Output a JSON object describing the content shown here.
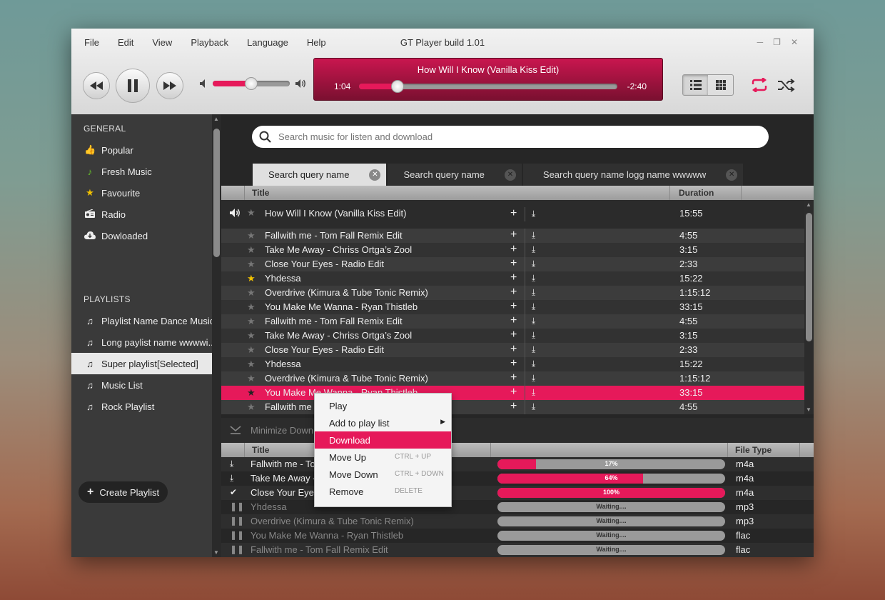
{
  "window": {
    "title": "GT Player build 1.01"
  },
  "menu": [
    "File",
    "Edit",
    "View",
    "Playback",
    "Language",
    "Help"
  ],
  "window_controls": [
    "minimize-icon",
    "restore-icon",
    "close-icon"
  ],
  "player": {
    "now_playing": "How Will I Know (Vanilla Kiss Edit)",
    "elapsed": "1:04",
    "remaining": "-2:40",
    "progress": 0.15,
    "volume": 0.5
  },
  "search": {
    "placeholder": "Search music for listen and download"
  },
  "tabs": [
    {
      "label": "Search query name",
      "active": true
    },
    {
      "label": "Search query name",
      "active": false
    },
    {
      "label": "Search query name logg name wwwww",
      "active": false
    }
  ],
  "sidebar": {
    "general_heading": "GENERAL",
    "general": [
      {
        "label": "Popular",
        "icon": "thumbs-up-icon"
      },
      {
        "label": "Fresh Music",
        "icon": "music-note-icon"
      },
      {
        "label": "Favourite",
        "icon": "star-icon"
      },
      {
        "label": "Radio",
        "icon": "radio-icon"
      },
      {
        "label": "Dowloaded",
        "icon": "cloud-download-icon"
      }
    ],
    "playlists_heading": "PLAYLISTS",
    "playlists": [
      {
        "label": "Playlist Name Dance Music"
      },
      {
        "label": "Long paylist name wwwwi..."
      },
      {
        "label": "Super playlist[Selected]"
      },
      {
        "label": "Music List"
      },
      {
        "label": "Rock Playlist"
      }
    ],
    "create_label": "Create Playlist"
  },
  "table": {
    "columns": [
      "Title",
      "Duration"
    ],
    "rows": [
      {
        "title": "How Will I Know (Vanilla Kiss Edit)",
        "duration": "15:55",
        "playing": true
      },
      {
        "title": "Fallwith me - Tom Fall Remix Edit",
        "duration": "4:55"
      },
      {
        "title": "Take Me Away - Chriss Ortga’s Zool",
        "duration": "3:15"
      },
      {
        "title": "Close Your Eyes - Radio Edit",
        "duration": "2:33"
      },
      {
        "title": "Yhdessa",
        "duration": "15:22",
        "favourite": true
      },
      {
        "title": "Overdrive (Kimura & Tube Tonic Remix)",
        "duration": "1:15:12"
      },
      {
        "title": "You Make Me Wanna - Ryan Thistleb",
        "duration": "33:15"
      },
      {
        "title": "Fallwith me - Tom Fall Remix Edit",
        "duration": "4:55"
      },
      {
        "title": "Take Me Away - Chriss Ortga’s Zool",
        "duration": "3:15"
      },
      {
        "title": "Close Your Eyes - Radio Edit",
        "duration": "2:33"
      },
      {
        "title": "Yhdessa",
        "duration": "15:22"
      },
      {
        "title": "Overdrive (Kimura & Tube Tonic Remix)",
        "duration": "1:15:12"
      },
      {
        "title": "You Make Me Wanna - Ryan Thistleb",
        "duration": "33:15",
        "selected": true
      },
      {
        "title": "Fallwith me - Tom Fall Remix Edit",
        "duration": "4:55"
      }
    ]
  },
  "downloads": {
    "minimize_label": "Minimize Downl",
    "columns": [
      "Title",
      "File Type"
    ],
    "rows": [
      {
        "title": "Fallwith me - Tom Fall Remix Edit",
        "status": "downloading",
        "progress": 0.17,
        "label": "17%",
        "type": "m4a"
      },
      {
        "title": "Take Me Away - Chriss Ortga’s Zool",
        "status": "downloading",
        "progress": 0.64,
        "label": "64%",
        "type": "m4a"
      },
      {
        "title": "Close Your Eyes - Radio Edit",
        "status": "done",
        "progress": 1.0,
        "label": "100%",
        "type": "m4a"
      },
      {
        "title": "Yhdessa",
        "status": "waiting",
        "progress": 0,
        "label": "Waiting....",
        "type": "mp3"
      },
      {
        "title": "Overdrive (Kimura & Tube Tonic Remix)",
        "status": "waiting",
        "progress": 0,
        "label": "Waiting....",
        "type": "mp3"
      },
      {
        "title": "You Make Me Wanna - Ryan Thistleb",
        "status": "waiting",
        "progress": 0,
        "label": "Waiting....",
        "type": "flac"
      },
      {
        "title": "Fallwith me - Tom Fall Remix Edit",
        "status": "waiting",
        "progress": 0,
        "label": "Waiting....",
        "type": "flac"
      }
    ]
  },
  "context_menu": [
    {
      "label": "Play",
      "shortcut": ""
    },
    {
      "label": "Add to play list",
      "shortcut": "",
      "submenu": true
    },
    {
      "label": "Download",
      "shortcut": "",
      "highlighted": true
    },
    {
      "label": "Move Up",
      "shortcut": "CTRL + UP"
    },
    {
      "label": "Move Down",
      "shortcut": "CTRL + DOWN"
    },
    {
      "label": "Remove",
      "shortcut": "DELETE"
    }
  ],
  "colors": {
    "accent": "#e6195a",
    "sidebar": "#3a3a3a",
    "panel": "#262626"
  }
}
